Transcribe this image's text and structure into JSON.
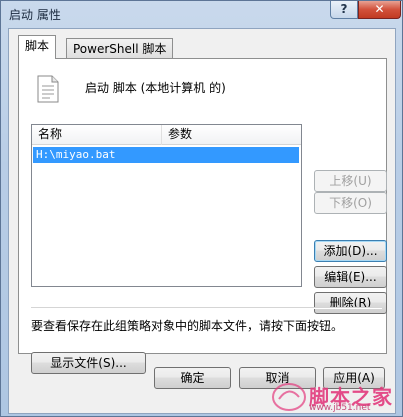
{
  "window": {
    "title": "启动 属性",
    "help_label": "?",
    "close_label": "✕"
  },
  "tabs": [
    {
      "label": "脚本",
      "active": true
    },
    {
      "label": "PowerShell 脚本",
      "active": false
    }
  ],
  "panel": {
    "heading": "启动 脚本 (本地计算机 的)",
    "list": {
      "columns": [
        "名称",
        "参数"
      ],
      "rows": [
        {
          "name": "H:\\miyao.bat",
          "params": "",
          "selected": true
        }
      ]
    },
    "buttons": {
      "up": "上移(U)",
      "down": "下移(O)",
      "add": "添加(D)...",
      "edit": "编辑(E)...",
      "remove": "删除(R)"
    },
    "hint": "要查看保存在此组策略对象中的脚本文件，请按下面按钮。",
    "show_files": "显示文件(S)..."
  },
  "footer": {
    "ok": "确定",
    "cancel": "取消",
    "apply": "应用(A)"
  },
  "watermark": {
    "brand": "脚本之家",
    "url": "www.jb51.net"
  },
  "colors": {
    "selection": "#3399ff",
    "close_button": "#c13a22",
    "watermark": "#e23a7d"
  }
}
